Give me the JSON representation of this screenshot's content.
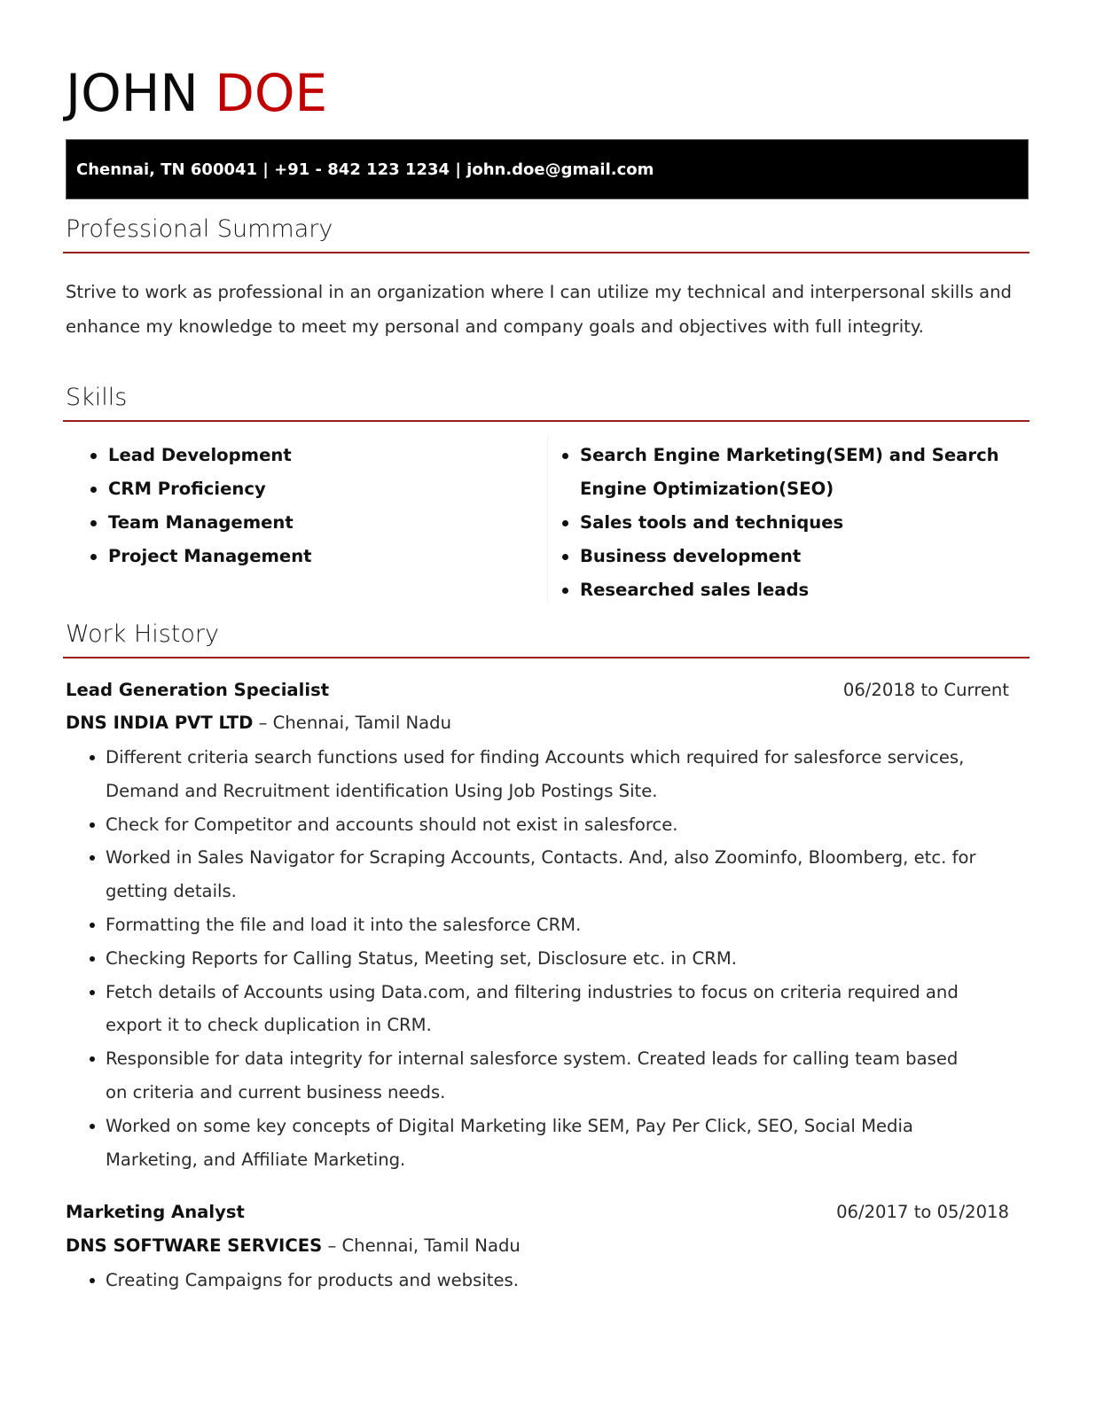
{
  "header": {
    "first_name": "JOHN",
    "last_name": "DOE",
    "contact": "Chennai, TN 600041 | +91 - 842 123 1234 | john.doe@gmail.com",
    "accent_color": "#c00000"
  },
  "summary": {
    "title": "Professional Summary",
    "text": "Strive to work as professional in an organization where I can utilize my technical and interpersonal skills and enhance my knowledge to meet my personal and company goals and objectives with full integrity."
  },
  "skills": {
    "title": "Skills",
    "left": [
      "Lead Development",
      "CRM Proficiency",
      "Team Management",
      "Project Management"
    ],
    "right": [
      "Search Engine Marketing(SEM) and Search Engine Optimization(SEO)",
      "Sales tools and techniques",
      "Business development",
      "Researched sales leads"
    ]
  },
  "work": {
    "title": "Work History",
    "jobs": [
      {
        "title": "Lead Generation Specialist",
        "dates": "06/2018 to Current",
        "company": "DNS INDIA PVT LTD",
        "location": " – Chennai, Tamil Nadu",
        "bullets": [
          "Different criteria search functions used for finding Accounts which required for salesforce services, Demand and Recruitment identification Using Job Postings Site.",
          "Check for Competitor and accounts should not exist in salesforce.",
          "Worked in Sales Navigator for Scraping Accounts, Contacts. And, also Zoominfo, Bloomberg, etc. for getting details.",
          "Formatting the file and load it into the salesforce CRM.",
          "Checking Reports for Calling Status, Meeting set, Disclosure etc. in CRM.",
          "Fetch details of Accounts using Data.com, and filtering industries to focus on criteria required and export it to check duplication in CRM.",
          "Responsible for data integrity for internal salesforce system. Created leads for calling team based on criteria and current business needs.",
          "Worked on some key concepts of Digital Marketing like SEM, Pay Per Click, SEO, Social Media Marketing, and Affiliate Marketing."
        ]
      },
      {
        "title": "Marketing Analyst",
        "dates": "06/2017 to 05/2018",
        "company": "DNS SOFTWARE SERVICES",
        "location": " – Chennai, Tamil Nadu",
        "bullets": [
          "Creating Campaigns for products and websites."
        ]
      }
    ]
  }
}
